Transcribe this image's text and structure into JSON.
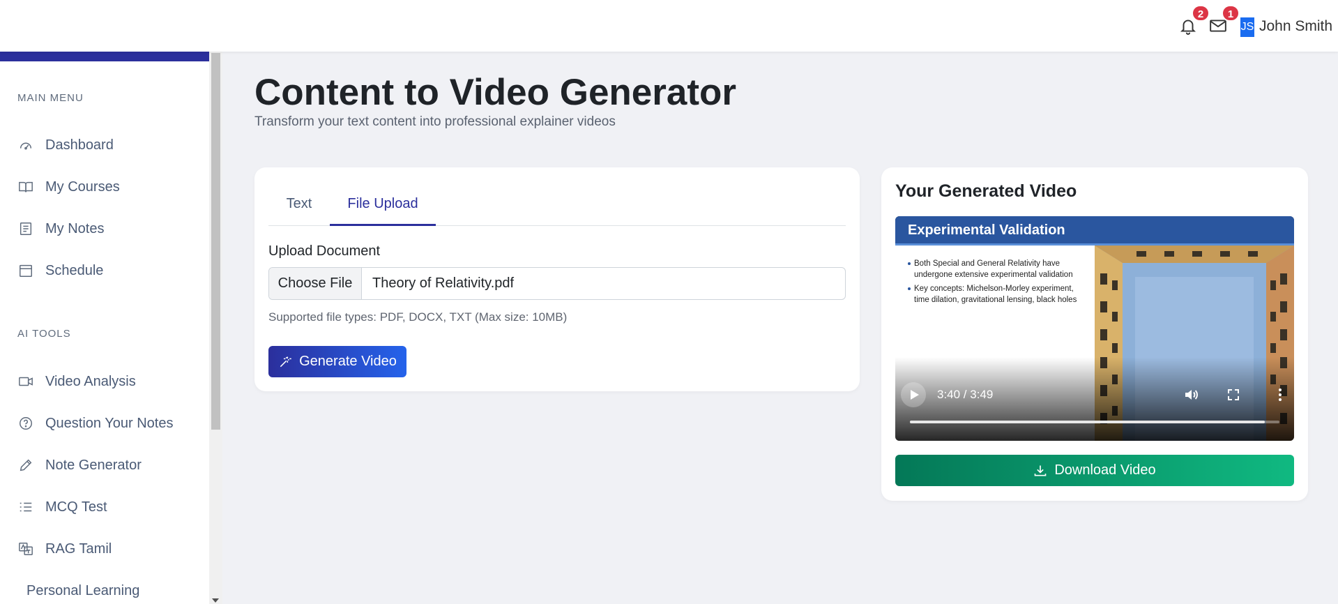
{
  "topbar": {
    "notifications_count": "2",
    "messages_count": "1",
    "avatar_initials": "JS",
    "user_name": "John Smith"
  },
  "sidebar": {
    "main_menu_label": "MAIN MENU",
    "main_items": [
      {
        "label": "Dashboard",
        "icon": "gauge-icon"
      },
      {
        "label": "My Courses",
        "icon": "book-icon"
      },
      {
        "label": "My Notes",
        "icon": "notes-icon"
      },
      {
        "label": "Schedule",
        "icon": "calendar-icon"
      }
    ],
    "ai_tools_label": "AI TOOLS",
    "ai_items": [
      {
        "label": "Video Analysis",
        "icon": "video-camera-icon"
      },
      {
        "label": "Question Your Notes",
        "icon": "question-circle-icon"
      },
      {
        "label": "Note Generator",
        "icon": "pencil-icon"
      },
      {
        "label": "MCQ Test",
        "icon": "list-icon"
      },
      {
        "label": "RAG Tamil",
        "icon": "translate-icon"
      }
    ],
    "extra_item": "Personal Learning"
  },
  "header": {
    "title": "Content to Video Generator",
    "subtitle": "Transform your text content into professional explainer videos"
  },
  "generator": {
    "tabs": [
      "Text",
      "File Upload"
    ],
    "active_tab": "File Upload",
    "upload_label": "Upload Document",
    "choose_file_label": "Choose File",
    "file_name": "Theory of Relativity.pdf",
    "help_text": "Supported file types: PDF, DOCX, TXT (Max size: 10MB)",
    "generate_label": "Generate Video"
  },
  "video": {
    "heading": "Your Generated Video",
    "slide_title": "Experimental Validation",
    "bullets": [
      "Both Special and General Relativity have undergone extensive experimental validation",
      "Key concepts: Michelson-Morley experiment, time dilation, gravitational lensing, black holes"
    ],
    "time_display": "3:40 / 3:49",
    "progress_fraction": 0.96,
    "download_label": "Download Video"
  },
  "colors": {
    "primary": "#2b2f9c",
    "success": "#10b981",
    "badge": "#dc3545"
  }
}
